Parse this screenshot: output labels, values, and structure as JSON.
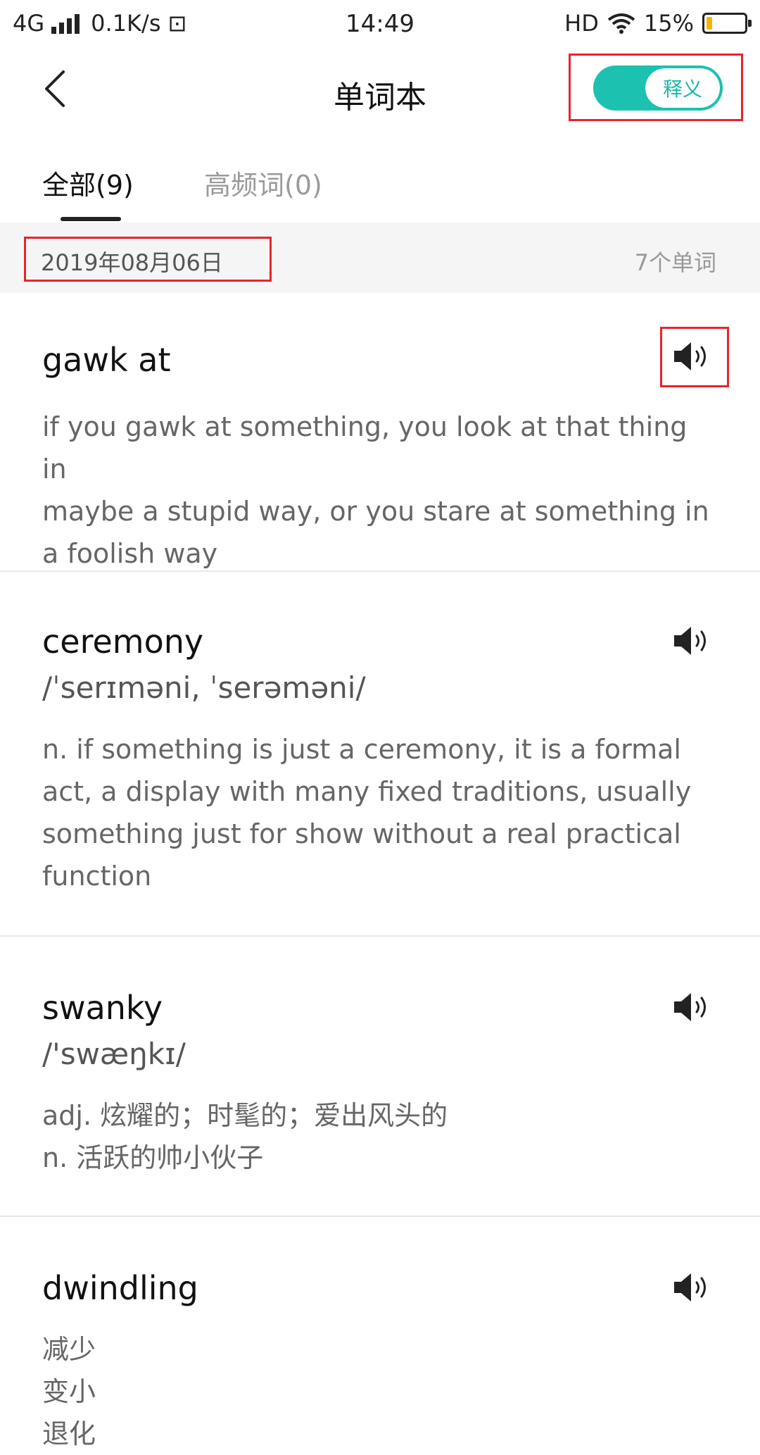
{
  "status_bar": {
    "network": "4G",
    "speed": "0.1K/s",
    "extra_icon": "⊡",
    "time": "14:49",
    "hd": "HD",
    "battery_text": "15%",
    "battery_level": 0.15,
    "battery_color": "#f2b705"
  },
  "header": {
    "title": "单词本",
    "toggle_label": "释义",
    "toggle_on": true,
    "accent_color": "#1cc1b0"
  },
  "tabs": [
    {
      "label": "全部(9)",
      "active": true
    },
    {
      "label": "高频词(0)",
      "active": false
    }
  ],
  "date_group": {
    "date": "2019年08月06日",
    "count": "7个单词"
  },
  "entries": [
    {
      "word": "gawk at",
      "phonetic": "",
      "definition": [
        "if you gawk at something, you look at that thing in",
        "maybe a stupid way, or you stare at something in",
        "a foolish way"
      ]
    },
    {
      "word": "ceremony",
      "phonetic": "/ˈserɪməni, ˈserəməni/",
      "definition": [
        "n. if something is just a ceremony, it is a formal",
        "act, a display with many fixed traditions, usually",
        "something just for show without a real practical",
        "function"
      ]
    },
    {
      "word": "swanky",
      "phonetic": "/'swæŋkɪ/",
      "definition": [
        "adj. 炫耀的；时髦的；爱出风头的",
        "n. 活跃的帅小伙子"
      ]
    },
    {
      "word": "dwindling",
      "phonetic": "",
      "definition": [
        "减少",
        "变小",
        "退化"
      ]
    }
  ],
  "icons": {
    "back": "chevron-left-icon",
    "speaker": "speaker-icon",
    "signal": "signal-icon",
    "wifi": "wifi-icon",
    "battery": "battery-icon"
  }
}
